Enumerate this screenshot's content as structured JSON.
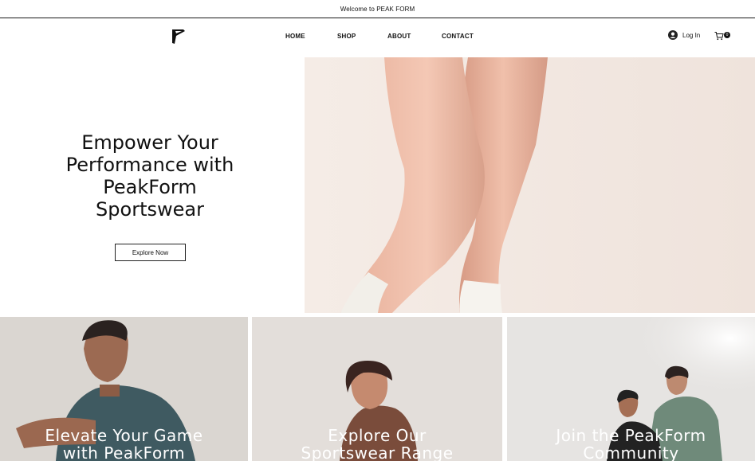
{
  "announcement": "Welcome to PEAK FORM",
  "nav": {
    "items": [
      {
        "label": "HOME"
      },
      {
        "label": "SHOP"
      },
      {
        "label": "ABOUT"
      },
      {
        "label": "CONTACT"
      }
    ]
  },
  "account": {
    "login_label": "Log In"
  },
  "cart": {
    "count": "0"
  },
  "hero": {
    "heading_lines": [
      "Empower Your",
      "Performance with",
      "PeakForm",
      "Sportswear"
    ],
    "button_label": "Explore Now"
  },
  "tiles": [
    {
      "caption_lines": [
        "Elevate Your Game",
        "with PeakForm"
      ]
    },
    {
      "caption_lines": [
        "Explore Our",
        "Sportswear Range"
      ]
    },
    {
      "caption_lines": [
        "Join the PeakForm",
        "Community"
      ]
    }
  ]
}
